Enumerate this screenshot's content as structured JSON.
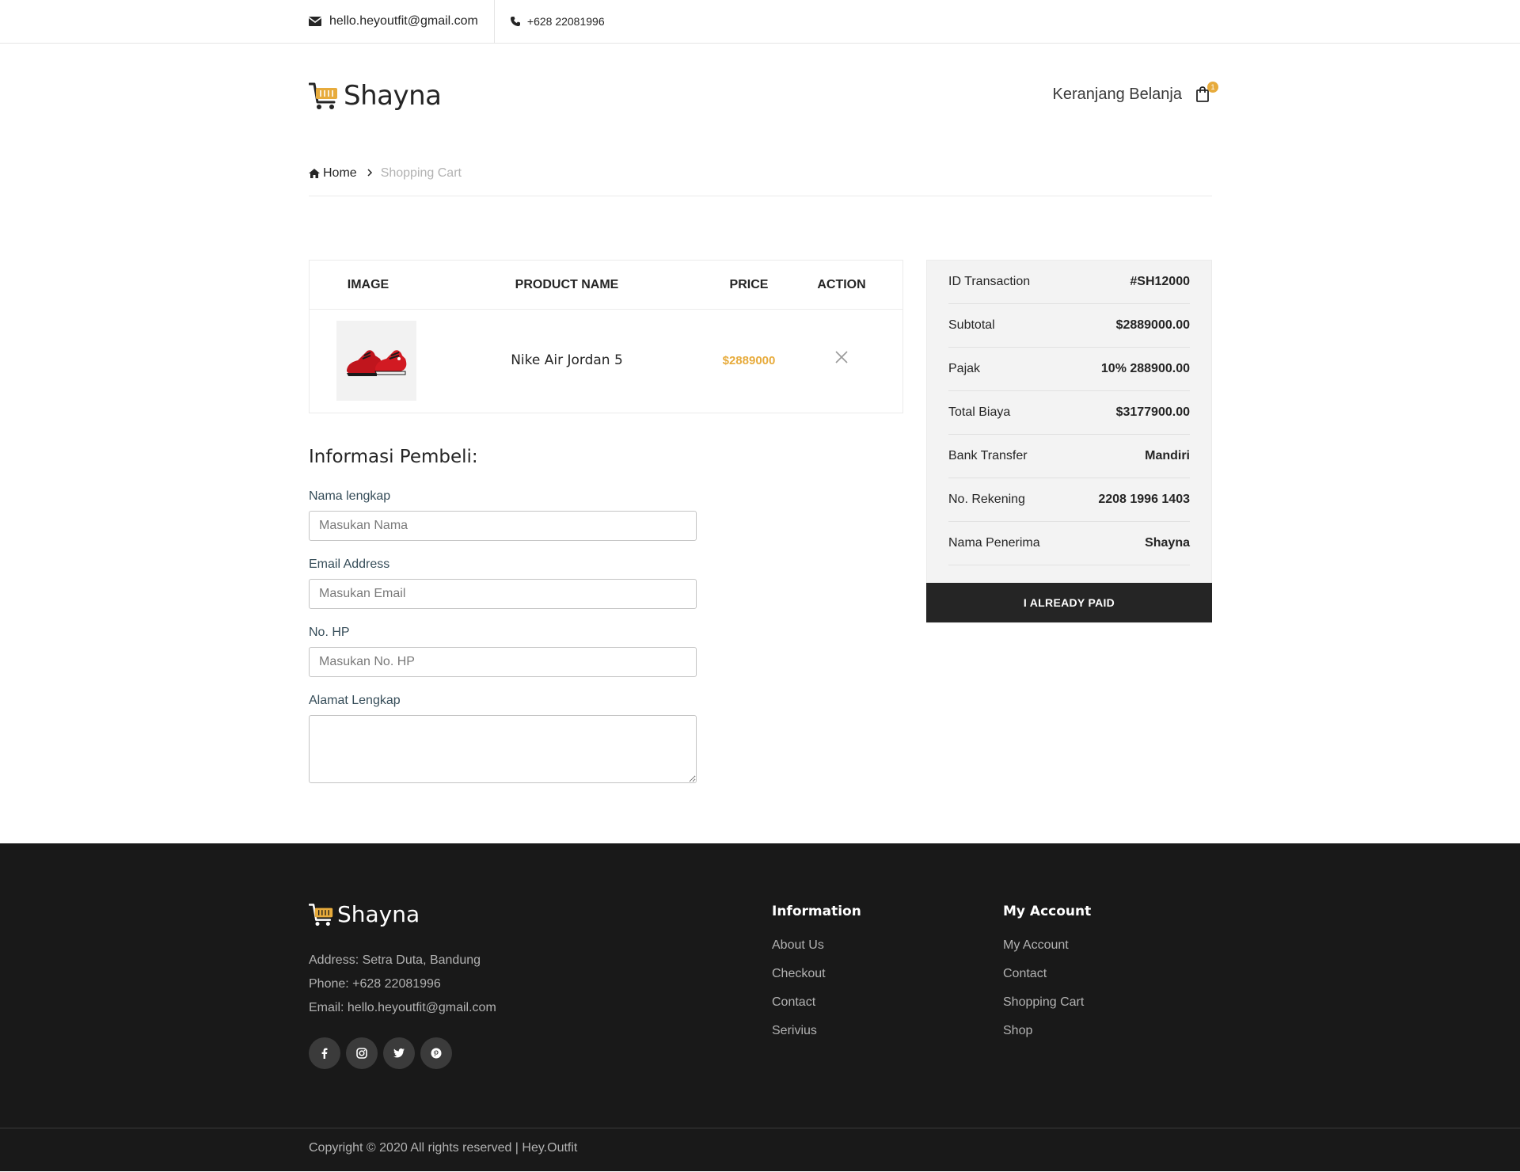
{
  "topbar": {
    "email": "hello.heyoutfit@gmail.com",
    "phone": "+628 22081996"
  },
  "header": {
    "brand": "Shayna",
    "cart_label": "Keranjang Belanja",
    "cart_count": "1"
  },
  "breadcrumb": {
    "home": "Home",
    "current": "Shopping Cart"
  },
  "cart_table": {
    "headers": [
      "IMAGE",
      "PRODUCT NAME",
      "PRICE",
      "ACTION"
    ],
    "items": [
      {
        "name": "Nike Air Jordan 5",
        "price": "$2889000"
      }
    ]
  },
  "buyer_form": {
    "title": "Informasi Pembeli:",
    "fields": [
      {
        "label": "Nama lengkap",
        "placeholder": "Masukan Nama"
      },
      {
        "label": "Email Address",
        "placeholder": "Masukan Email"
      },
      {
        "label": "No. HP",
        "placeholder": "Masukan No. HP"
      },
      {
        "label": "Alamat Lengkap",
        "placeholder": ""
      }
    ]
  },
  "summary": {
    "rows": [
      {
        "label": "ID Transaction",
        "value": "#SH12000"
      },
      {
        "label": "Subtotal",
        "value": "$2889000.00"
      },
      {
        "label": "Pajak",
        "value": "10% 288900.00"
      },
      {
        "label": "Total Biaya",
        "value": "$3177900.00"
      },
      {
        "label": "Bank Transfer",
        "value": "Mandiri"
      },
      {
        "label": "No. Rekening",
        "value": "2208 1996 1403"
      },
      {
        "label": "Nama Penerima",
        "value": "Shayna"
      }
    ],
    "button": "I ALREADY PAID"
  },
  "footer": {
    "brand": "Shayna",
    "address": "Address: Setra Duta, Bandung",
    "phone": "Phone: +628 22081996",
    "email": "Email: hello.heyoutfit@gmail.com",
    "socials": [
      "facebook-icon",
      "instagram-icon",
      "twitter-icon",
      "pinterest-icon"
    ],
    "information": {
      "title": "Information",
      "links": [
        "About Us",
        "Checkout",
        "Contact",
        "Serivius"
      ]
    },
    "account": {
      "title": "My Account",
      "links": [
        "My Account",
        "Contact",
        "Shopping Cart",
        "Shop"
      ]
    },
    "copyright": "Copyright © 2020 All rights reserved | Hey.Outfit"
  },
  "colors": {
    "accent": "#e7ab3c",
    "dark": "#252525",
    "footer_bg": "#191919"
  }
}
